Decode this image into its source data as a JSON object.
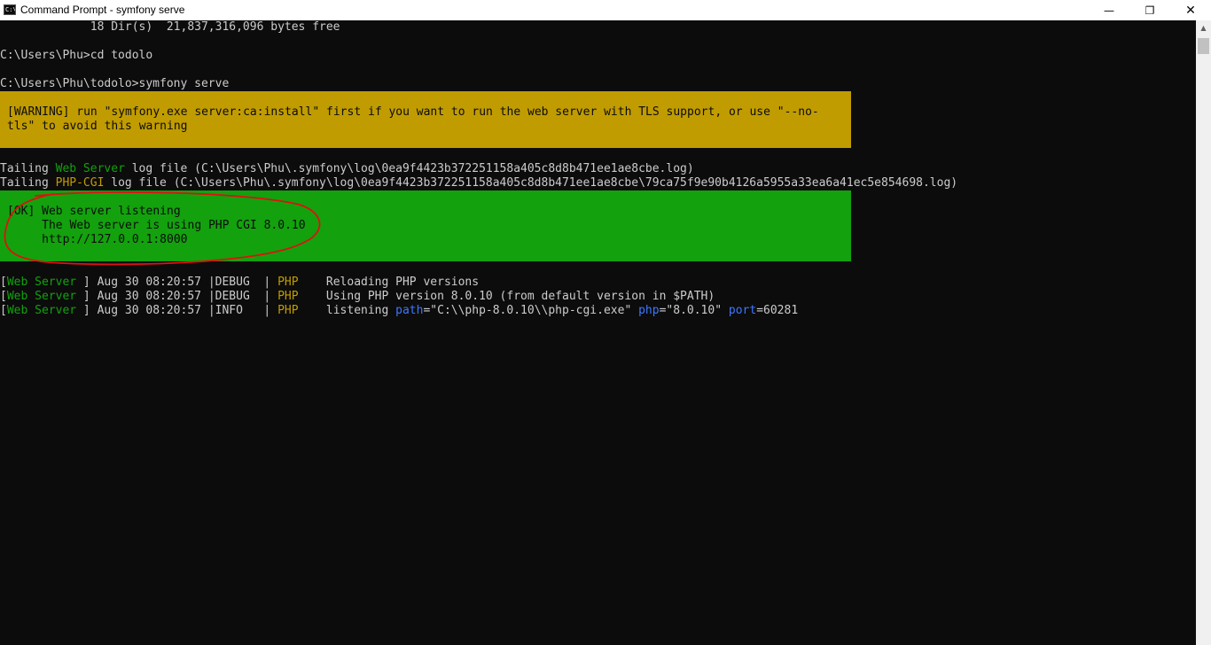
{
  "window": {
    "title": "Command Prompt - symfony  serve",
    "icon": "cmd-icon",
    "icon_glyph": "C:\\",
    "minimize_glyph": "—",
    "maximize_glyph": "❐",
    "close_glyph": "✕"
  },
  "terminal": {
    "dir_summary": "             18 Dir(s)  21,837,316,096 bytes free",
    "prompt_cd": "C:\\Users\\Phu>cd todolo",
    "prompt_serve": "C:\\Users\\Phu\\todolo>symfony serve",
    "warning_lines": [
      "[WARNING] run \"symfony.exe server:ca:install\" first if you want to run the web server with TLS support, or use \"--no-",
      "tls\" to avoid this warning"
    ],
    "tailing": [
      {
        "prefix": "Tailing ",
        "source": "Web Server",
        "rest": " log file (C:\\Users\\Phu\\.symfony\\log\\0ea9f4423b372251158a405c8d8b471ee1ae8cbe.log)"
      },
      {
        "prefix": "Tailing ",
        "source": "PHP-CGI",
        "rest": " log file (C:\\Users\\Phu\\.symfony\\log\\0ea9f4423b372251158a405c8d8b471ee1ae8cbe\\79ca75f9e90b4126a5955a33ea6a41ec5e854698.log)"
      }
    ],
    "ok_lines": [
      "[OK] Web server listening",
      "     The Web server is using PHP CGI 8.0.10",
      "     http://127.0.0.1:8000"
    ],
    "log_entries": [
      {
        "open": "[",
        "source": "Web Server",
        "meta": " ] Aug 30 08:20:57 |DEBUG  | ",
        "tag": "PHP",
        "message": "    Reloading PHP versions"
      },
      {
        "open": "[",
        "source": "Web Server",
        "meta": " ] Aug 30 08:20:57 |DEBUG  | ",
        "tag": "PHP",
        "message": "    Using PHP version 8.0.10 (from default version in $PATH)"
      },
      {
        "open": "[",
        "source": "Web Server",
        "meta": " ] Aug 30 08:20:57 |INFO   | ",
        "tag": "PHP",
        "message": "    listening ",
        "key_path": "path",
        "val_path": "=\"C:\\\\php-8.0.10\\\\php-cgi.exe\" ",
        "key_php": "php",
        "val_php": "=\"8.0.10\" ",
        "key_port": "port",
        "val_port": "=60281"
      }
    ]
  },
  "scrollbar": {
    "up_glyph": "▲"
  },
  "colors": {
    "background": "#0c0c0c",
    "text": "#cccccc",
    "warning_bg": "#c19c00",
    "ok_bg": "#13a10e",
    "source_green": "#13a10e",
    "tag_yellow": "#c19c00",
    "key_blue": "#3b78ff",
    "annotation_red": "#e01010"
  }
}
